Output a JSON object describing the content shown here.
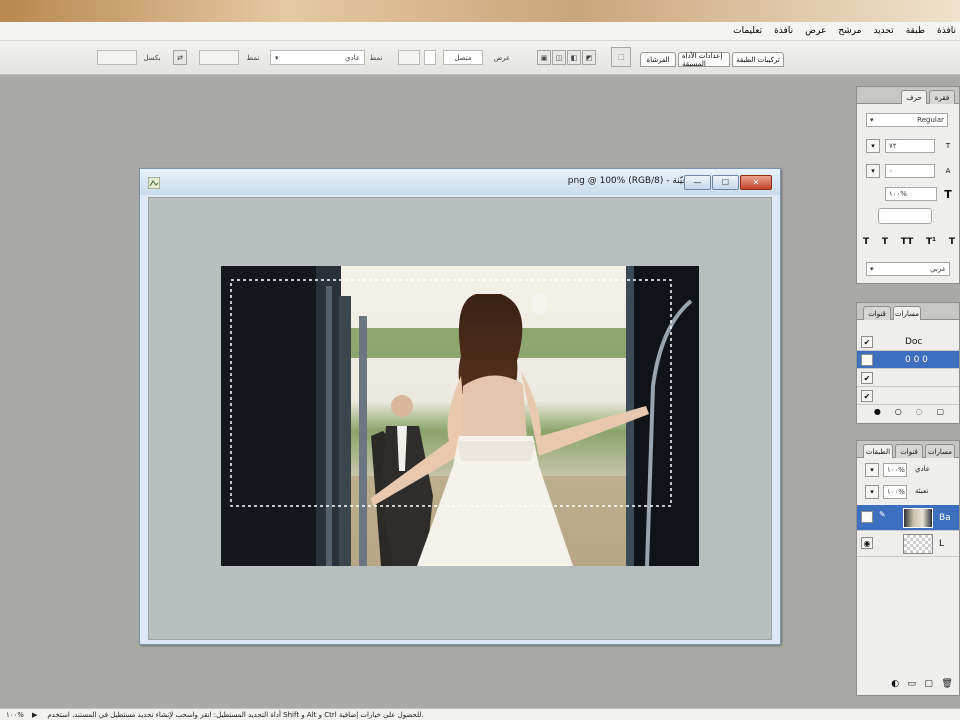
{
  "menubar": {
    "items": [
      "نافذة",
      "طبقة",
      "تحديد",
      "مرشح",
      "عرض",
      "نافذة",
      "تعليمات"
    ]
  },
  "options": {
    "field1": "",
    "field2": "",
    "label_px": "بكسل",
    "dropdown": "عادي",
    "ratio_label": "نمط",
    "width_field": "",
    "feather": "بكسل",
    "smooth": "متصل",
    "style_label": "عرض",
    "tab_brushes": "الفرشاة",
    "tab_presets": "إعدادات الأداة المسبقة",
    "tab_comps": "تركيبات الطبقة"
  },
  "document": {
    "title": "png @ 100% (RGB/8) - عيّنة",
    "btn_min": "—",
    "btn_max": "☐",
    "btn_close": "✕"
  },
  "char_panel": {
    "tab1": "حرف",
    "tab2": "فقرة",
    "font_style": "Regular",
    "size_value": "٧٢",
    "leading_value": "٠",
    "tracking_value": "١٠٠%",
    "baseline": "",
    "lang": "عربي"
  },
  "paths_panel": {
    "tab1": "مسارات",
    "tab2": "قنوات",
    "items": [
      "Doc",
      "0 0 0",
      "",
      ""
    ]
  },
  "layers_panel": {
    "tab1": "الطبقات",
    "tab2": "قنوات",
    "tab3": "مسارات",
    "blend_mode": "عادي",
    "opacity": "١٠٠%",
    "fill": "١٠٠%",
    "layer1": "Ba",
    "layer2": "L"
  },
  "status": {
    "zoom": "١٠٠%",
    "text": "أداة التحديد المستطيل: انقر واسحب لإنشاء تحديد مستطيل في المستند، استخدم Shift و Alt و Ctrl للحصول على خيارات إضافية."
  },
  "colors": {
    "accent": "#4a7fc1",
    "workspace": "#a9aaa7",
    "selected_layer": "#3c6fbf"
  }
}
